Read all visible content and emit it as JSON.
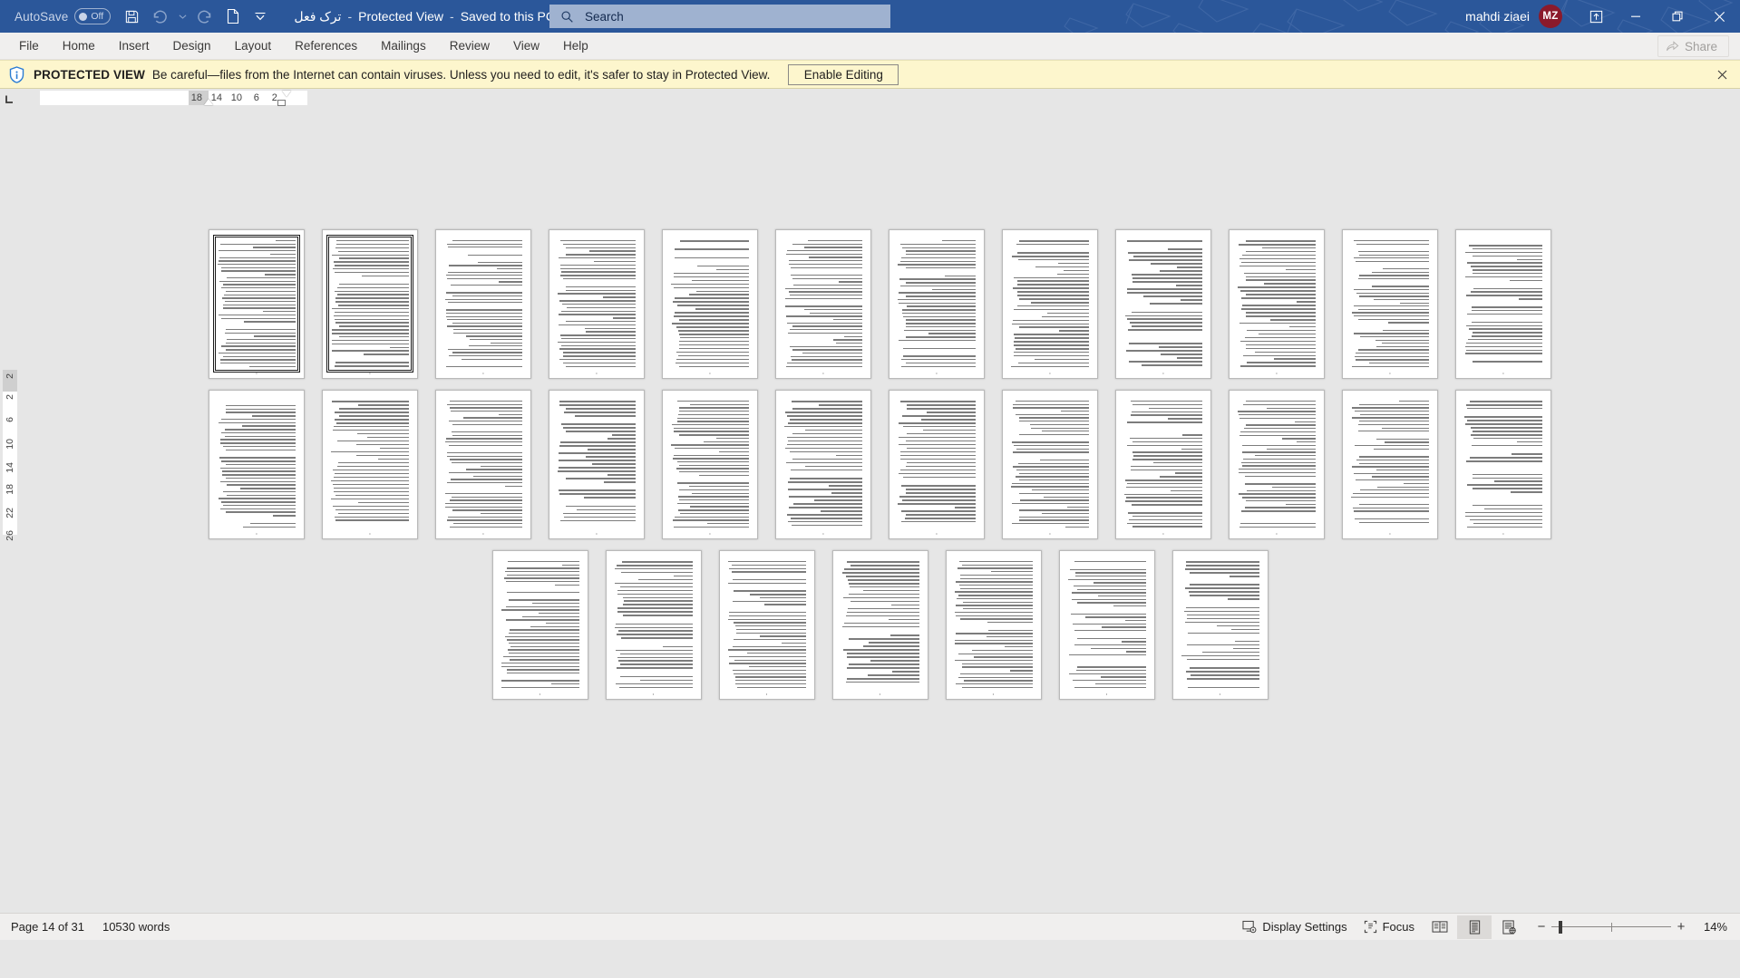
{
  "titlebar": {
    "autosave_label": "AutoSave",
    "autosave_state": "Off",
    "quick_access": [
      {
        "name": "save-icon",
        "label": "Save"
      },
      {
        "name": "undo-icon",
        "label": "Undo"
      },
      {
        "name": "redo-icon",
        "label": "Redo"
      },
      {
        "name": "new-document-icon",
        "label": "New"
      },
      {
        "name": "customize-quick-access-toolbar-icon",
        "label": "Customize Quick Access Toolbar"
      }
    ],
    "document_name": "ترک فعل",
    "separator": "-",
    "protected_view_state": "Protected View",
    "save_location": "Saved to this PC",
    "account_name": "mahdi ziaei",
    "account_initials": "MZ",
    "ribbon_display_options": "Ribbon Display Options",
    "minimize": "Minimize",
    "restore": "Restore Down",
    "close": "Close",
    "bg_color": "#2b579a"
  },
  "search": {
    "placeholder": "Search",
    "icon": "search-icon"
  },
  "ribbon": {
    "tabs": [
      "File",
      "Home",
      "Insert",
      "Design",
      "Layout",
      "References",
      "Mailings",
      "Review",
      "View",
      "Help"
    ],
    "share_label": "Share",
    "share_icon": "share-icon"
  },
  "protected_view": {
    "icon": "shield-info-icon",
    "title": "PROTECTED VIEW",
    "message": "Be careful—files from the Internet can contain viruses. Unless you need to edit, it's safer to stay in Protected View.",
    "enable_button": "Enable Editing",
    "close_icon": "close-icon",
    "bg_color": "#fdf6cd"
  },
  "ruler": {
    "corner_icon": "tab-stop-left-icon",
    "horizontal_numbers": [
      "18",
      "14",
      "10",
      "6",
      "2"
    ],
    "vertical_numbers": [
      "2",
      "2",
      "6",
      "10",
      "14",
      "18",
      "22",
      "26"
    ]
  },
  "document": {
    "rows": [
      {
        "count": 12
      },
      {
        "count": 12
      },
      {
        "count": 7
      }
    ],
    "page_count_total": 31
  },
  "statusbar": {
    "page_indicator": "Page 14 of 31",
    "word_count": "10530 words",
    "display_settings": "Display Settings",
    "display_settings_icon": "display-settings-icon",
    "focus": "Focus",
    "focus_icon": "focus-icon",
    "views": [
      {
        "name": "read-mode-icon",
        "label": "Read Mode",
        "active": false
      },
      {
        "name": "print-layout-icon",
        "label": "Print Layout",
        "active": true
      },
      {
        "name": "web-layout-icon",
        "label": "Web Layout",
        "active": false
      }
    ],
    "zoom_out": "−",
    "zoom_in": "+",
    "zoom_level": "14%"
  }
}
